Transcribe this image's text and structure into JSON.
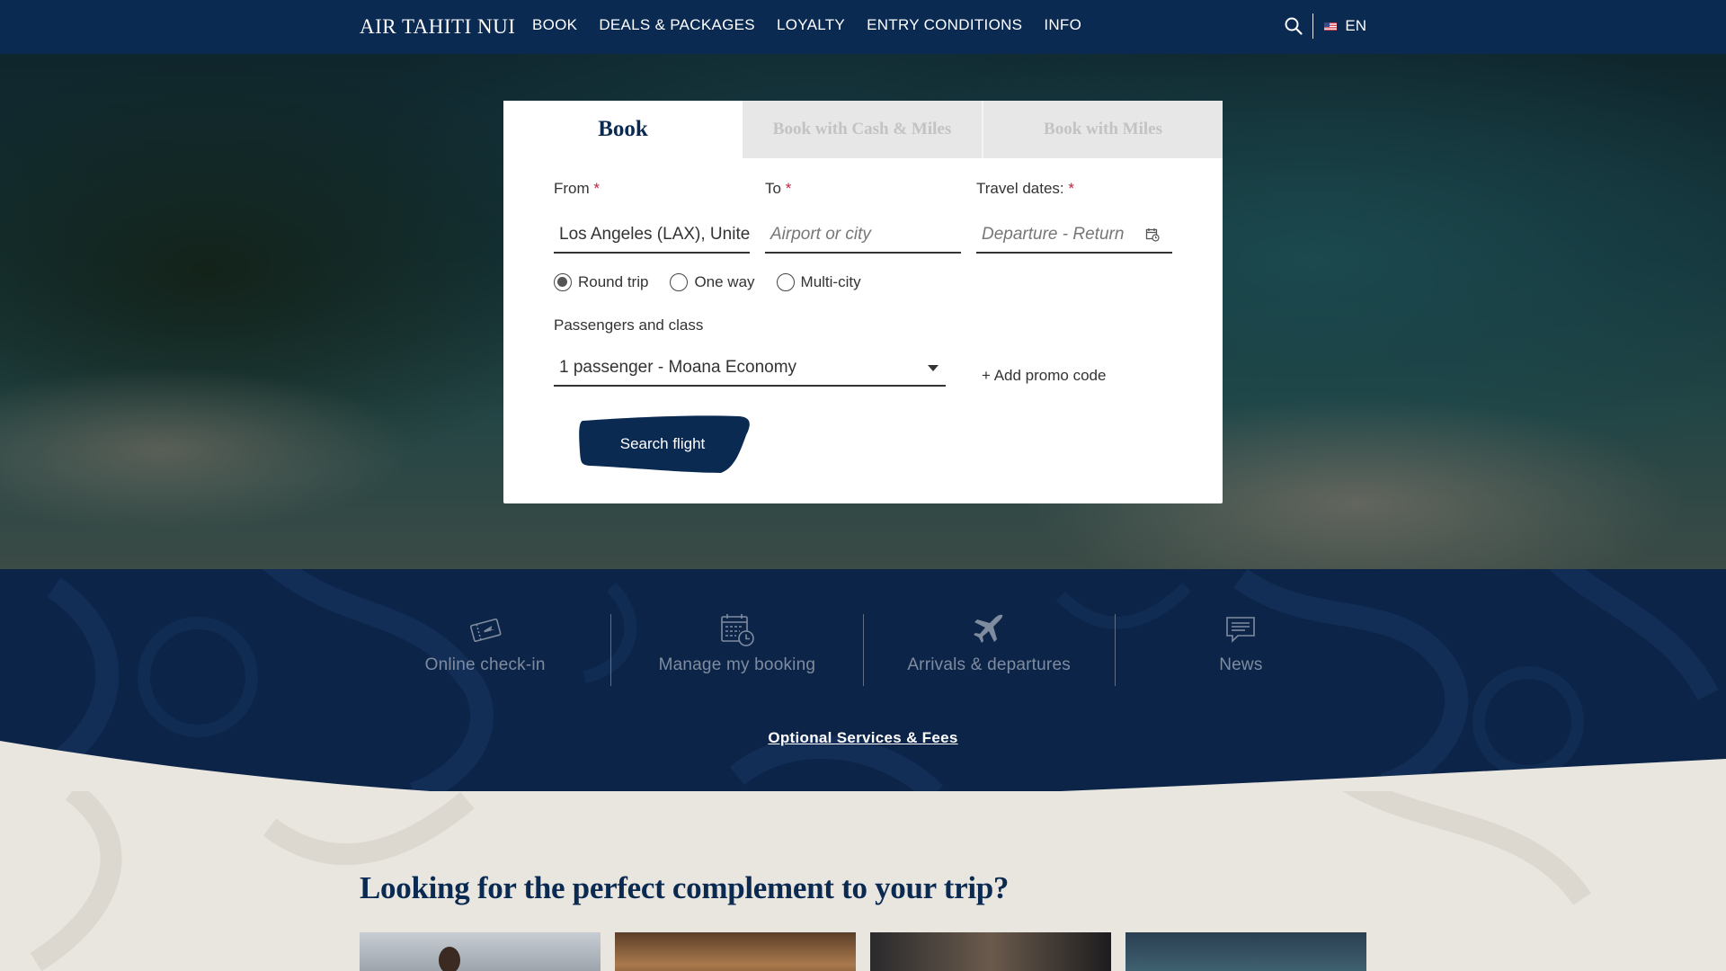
{
  "header": {
    "logo": "AIR TAHITI NUI",
    "nav": [
      "BOOK",
      "DEALS & PACKAGES",
      "LOYALTY",
      "ENTRY CONDITIONS",
      "INFO"
    ],
    "language": "EN",
    "icons": {
      "search": "search-icon",
      "flag": "us-flag-icon"
    }
  },
  "booking": {
    "tabs": [
      "Book",
      "Book with Cash & Miles",
      "Book with Miles"
    ],
    "active_tab": "Book",
    "from": {
      "label": "From",
      "required": "*",
      "value": "Los Angeles (LAX), United States"
    },
    "to": {
      "label": "To",
      "required": "*",
      "placeholder": "Airport or city"
    },
    "dates": {
      "label": "Travel dates:",
      "required": "*",
      "placeholder": "Departure - Return",
      "icon": "calendar-icon"
    },
    "trip_types": [
      "Round trip",
      "One way",
      "Multi-city"
    ],
    "selected_trip_type": "Round trip",
    "passengers": {
      "label": "Passengers and class",
      "value": "1 passenger - Moana Economy"
    },
    "promo": "+ Add promo code",
    "search_button": "Search flight"
  },
  "quick_links": [
    {
      "label": "Online check-in",
      "icon": "ticket-icon"
    },
    {
      "label": "Manage my booking",
      "icon": "calendar-clock-icon"
    },
    {
      "label": "Arrivals & departures",
      "icon": "airplane-icon"
    },
    {
      "label": "News",
      "icon": "speech-bubble-icon"
    }
  ],
  "optional_services": "Optional Services & Fees",
  "complement": {
    "title": "Looking for the perfect complement to your trip?"
  },
  "colors": {
    "navy": "#0b2a52",
    "band": "#0b2447",
    "required": "#c0243a",
    "inactive_tab_bg": "#e7e7e7",
    "inactive_tab_text": "#c3c3c3",
    "page_bg": "#e9e6e0"
  }
}
